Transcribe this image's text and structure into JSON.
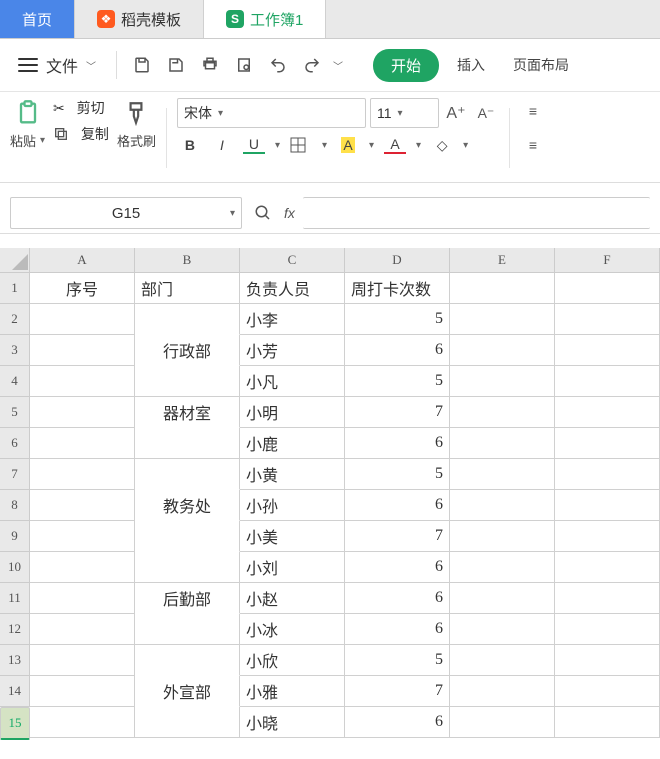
{
  "tabs": {
    "home": "首页",
    "template": "稻壳模板",
    "workbook": "工作簿1"
  },
  "toolbar": {
    "file": "文件",
    "start": "开始",
    "insert": "插入",
    "page_layout": "页面布局"
  },
  "ribbon": {
    "paste": "粘贴",
    "cut": "剪切",
    "copy": "复制",
    "format_painter": "格式刷",
    "font_name": "宋体",
    "font_size": "11"
  },
  "namebox": "G15",
  "columns": [
    "A",
    "B",
    "C",
    "D",
    "E",
    "F"
  ],
  "rows": [
    "1",
    "2",
    "3",
    "4",
    "5",
    "6",
    "7",
    "8",
    "9",
    "10",
    "11",
    "12",
    "13",
    "14",
    "15"
  ],
  "header": {
    "A": "序号",
    "B": "部门",
    "C": "负责人员",
    "D": "周打卡次数"
  },
  "dept": {
    "2": "行政部",
    "4": "器材室",
    "6": "教务处",
    "10": "后勤部",
    "12": "外宣部"
  },
  "people": {
    "2": "小李",
    "3": "小芳",
    "4": "小凡",
    "5": "小明",
    "6": "小鹿",
    "7": "小黄",
    "8": "小孙",
    "9": "小美",
    "10": "小刘",
    "11": "小赵",
    "12": "小冰",
    "13": "小欣",
    "14": "小雅",
    "15": "小晓"
  },
  "counts": {
    "2": "5",
    "3": "6",
    "4": "5",
    "5": "7",
    "6": "6",
    "7": "5",
    "8": "6",
    "9": "7",
    "10": "6",
    "11": "6",
    "12": "6",
    "13": "5",
    "14": "7",
    "15": "6"
  }
}
